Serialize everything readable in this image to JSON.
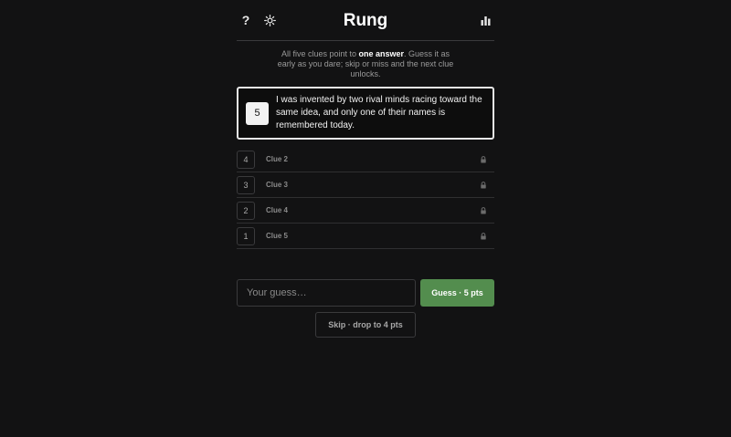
{
  "header": {
    "help_label": "?",
    "title": "Rung",
    "theme_icon": "sun-icon",
    "stats_icon": "bar-chart-icon"
  },
  "intro": {
    "part1": "All five clues point to ",
    "emphasis": "one answer",
    "part2": ". Guess it as early as you dare; skip or miss and the next clue unlocks."
  },
  "active_clue": {
    "points": "5",
    "text": "I was invented by two rival minds racing toward the same idea, and only one of their names is remembered today."
  },
  "locked_clues": [
    {
      "points": "4",
      "label": "Clue 2"
    },
    {
      "points": "3",
      "label": "Clue 3"
    },
    {
      "points": "2",
      "label": "Clue 4"
    },
    {
      "points": "1",
      "label": "Clue 5"
    }
  ],
  "guess": {
    "placeholder": "Your guess…",
    "value": "",
    "button_label": "Guess · 5 pts"
  },
  "skip": {
    "button_label": "Skip · drop to 4 pts"
  },
  "colors": {
    "background": "#121213",
    "accent_green": "#538d4e",
    "border": "#3a3a3c"
  }
}
